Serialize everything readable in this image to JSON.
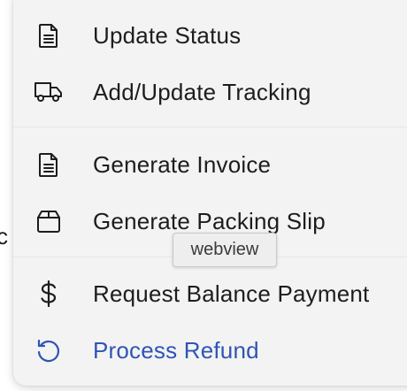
{
  "background": {
    "partial_text": "c"
  },
  "menu": {
    "items": [
      {
        "label": "Update Status",
        "icon": "document-icon"
      },
      {
        "label": "Add/Update Tracking",
        "icon": "truck-icon"
      },
      {
        "label": "Generate Invoice",
        "icon": "document-icon"
      },
      {
        "label": "Generate Packing Slip",
        "icon": "box-icon"
      },
      {
        "label": "Request Balance Payment",
        "icon": "dollar-icon"
      },
      {
        "label": "Process Refund",
        "icon": "refund-icon"
      }
    ]
  },
  "tooltip": {
    "text": "webview"
  },
  "colors": {
    "menu_background": "#f3f3f4",
    "text": "#1d1d1f",
    "accent": "#2f55b3"
  }
}
